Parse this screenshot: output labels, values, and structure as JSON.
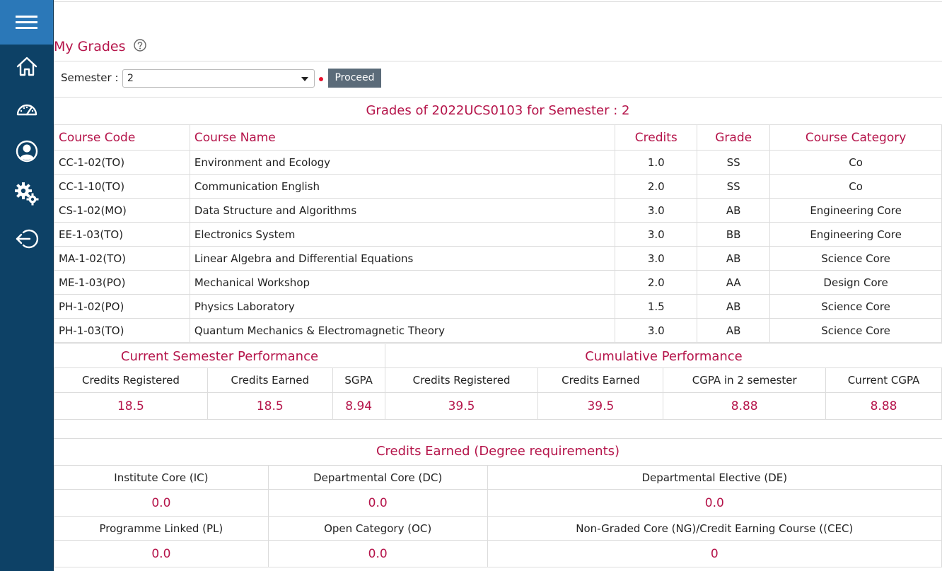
{
  "sidebar": {
    "icons": [
      "menu-icon",
      "home-icon",
      "dashboard-icon",
      "user-icon",
      "settings-icon",
      "logout-icon"
    ],
    "accent": "#0d4166",
    "menu_bg": "#2b78b8"
  },
  "page": {
    "title": "My Grades",
    "accent": "#b5144a"
  },
  "semester": {
    "label": "Semester :",
    "value": "2",
    "proceed_label": "Proceed"
  },
  "grades": {
    "heading": "Grades of 2022UCS0103 for Semester : 2",
    "columns": [
      "Course Code",
      "Course Name",
      "Credits",
      "Grade",
      "Course Category"
    ],
    "rows": [
      [
        "CC-1-02(TO)",
        "Environment and Ecology",
        "1.0",
        "SS",
        "Co"
      ],
      [
        "CC-1-10(TO)",
        "Communication English",
        "2.0",
        "SS",
        "Co"
      ],
      [
        "CS-1-02(MO)",
        "Data Structure and Algorithms",
        "3.0",
        "AB",
        "Engineering Core"
      ],
      [
        "EE-1-03(TO)",
        "Electronics System",
        "3.0",
        "BB",
        "Engineering Core"
      ],
      [
        "MA-1-02(TO)",
        "Linear Algebra and Differential Equations",
        "3.0",
        "AB",
        "Science Core"
      ],
      [
        "ME-1-03(PO)",
        "Mechanical Workshop",
        "2.0",
        "AA",
        "Design Core"
      ],
      [
        "PH-1-02(PO)",
        "Physics Laboratory",
        "1.5",
        "AB",
        "Science Core"
      ],
      [
        "PH-1-03(TO)",
        "Quantum Mechanics & Electromagnetic Theory",
        "3.0",
        "AB",
        "Science Core"
      ]
    ]
  },
  "performance": {
    "current_heading": "Current Semester Performance",
    "cumulative_heading": "Cumulative Performance",
    "labels": [
      "Credits Registered",
      "Credits Earned",
      "SGPA",
      "Credits Registered",
      "Credits Earned",
      "CGPA in 2 semester",
      "Current CGPA"
    ],
    "values": [
      "18.5",
      "18.5",
      "8.94",
      "39.5",
      "39.5",
      "8.88",
      "8.88"
    ]
  },
  "credits_earned": {
    "heading": "Credits Earned (Degree requirements)",
    "row1_labels": [
      "Institute Core (IC)",
      "Departmental Core (DC)",
      "Departmental Elective (DE)"
    ],
    "row1_values": [
      "0.0",
      "0.0",
      "0.0"
    ],
    "row2_labels": [
      "Programme Linked (PL)",
      "Open Category (OC)",
      "Non-Graded Core (NG)/Credit Earning Course ((CEC)"
    ],
    "row2_values": [
      "0.0",
      "0.0",
      "0"
    ]
  }
}
